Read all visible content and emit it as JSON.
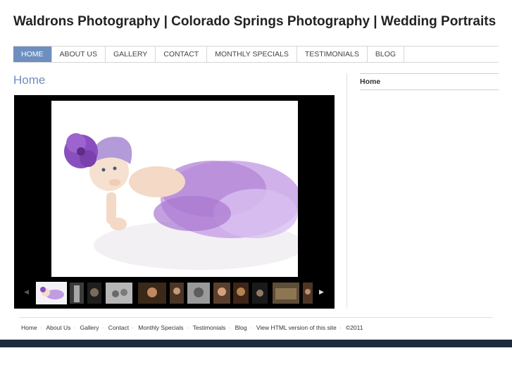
{
  "site": {
    "title": "Waldrons Photography | Colorado Springs Photography | Wedding Portraits"
  },
  "nav": {
    "items": [
      {
        "label": "Home",
        "active": true
      },
      {
        "label": "About Us"
      },
      {
        "label": "Gallery"
      },
      {
        "label": "Contact"
      },
      {
        "label": "Monthly Specials"
      },
      {
        "label": "Testimonials"
      },
      {
        "label": "Blog"
      }
    ]
  },
  "page": {
    "heading": "Home"
  },
  "sidebar": {
    "link": "Home"
  },
  "slideshow": {
    "thumbnail_count": 15,
    "selected_index": 0,
    "prev_icon": "chevron-left-icon",
    "next_icon": "chevron-right-icon"
  },
  "footer": {
    "links": [
      "Home",
      "About Us",
      "Gallery",
      "Contact",
      "Monthly Specials",
      "Testimonials",
      "Blog",
      "View HTML version of this site"
    ],
    "copyright": "©2011"
  },
  "colors": {
    "accent": "#6d8fbf",
    "bottom_bar": "#1c2a3c",
    "photo_tutu": "#b58ad8"
  }
}
